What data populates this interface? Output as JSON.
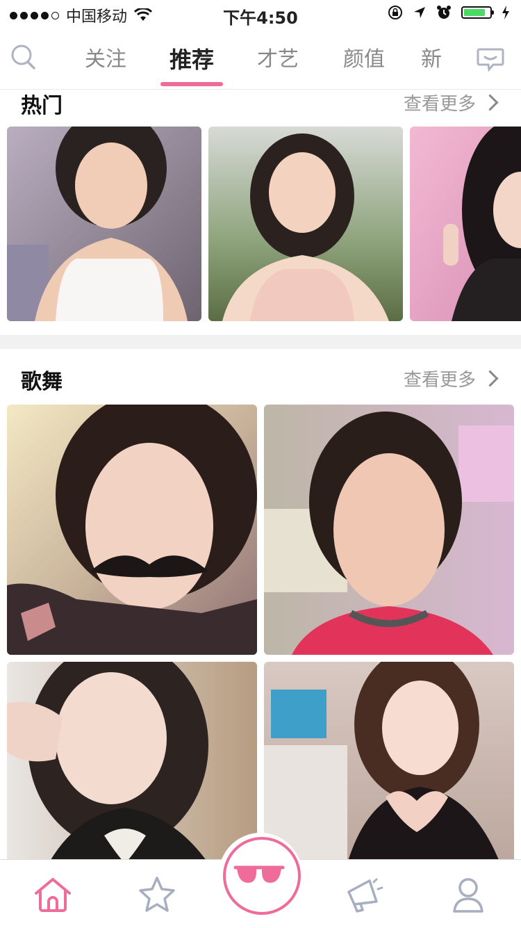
{
  "status_bar": {
    "carrier": "中国移动",
    "time": "下午4:50"
  },
  "nav": {
    "search_icon": "search-icon",
    "message_icon": "chat-bubble-icon",
    "tabs": [
      {
        "label": "关注",
        "active": false
      },
      {
        "label": "推荐",
        "active": true
      },
      {
        "label": "才艺",
        "active": false
      },
      {
        "label": "颜值",
        "active": false
      },
      {
        "label": "新",
        "active": false
      }
    ]
  },
  "sections": {
    "hot": {
      "title": "热门",
      "more_label": "查看更多",
      "items": [
        "hot-photo-1",
        "hot-photo-2",
        "hot-photo-3"
      ]
    },
    "song_dance": {
      "title": "歌舞",
      "more_label": "查看更多",
      "items": [
        "photo-1",
        "photo-2",
        "photo-3",
        "photo-4"
      ]
    }
  },
  "tab_bar": {
    "items": [
      "home-icon",
      "star-icon",
      "sunglasses-icon",
      "megaphone-icon",
      "profile-icon"
    ],
    "accent": "#ef6b9a",
    "inactive": "#a7aec0"
  }
}
